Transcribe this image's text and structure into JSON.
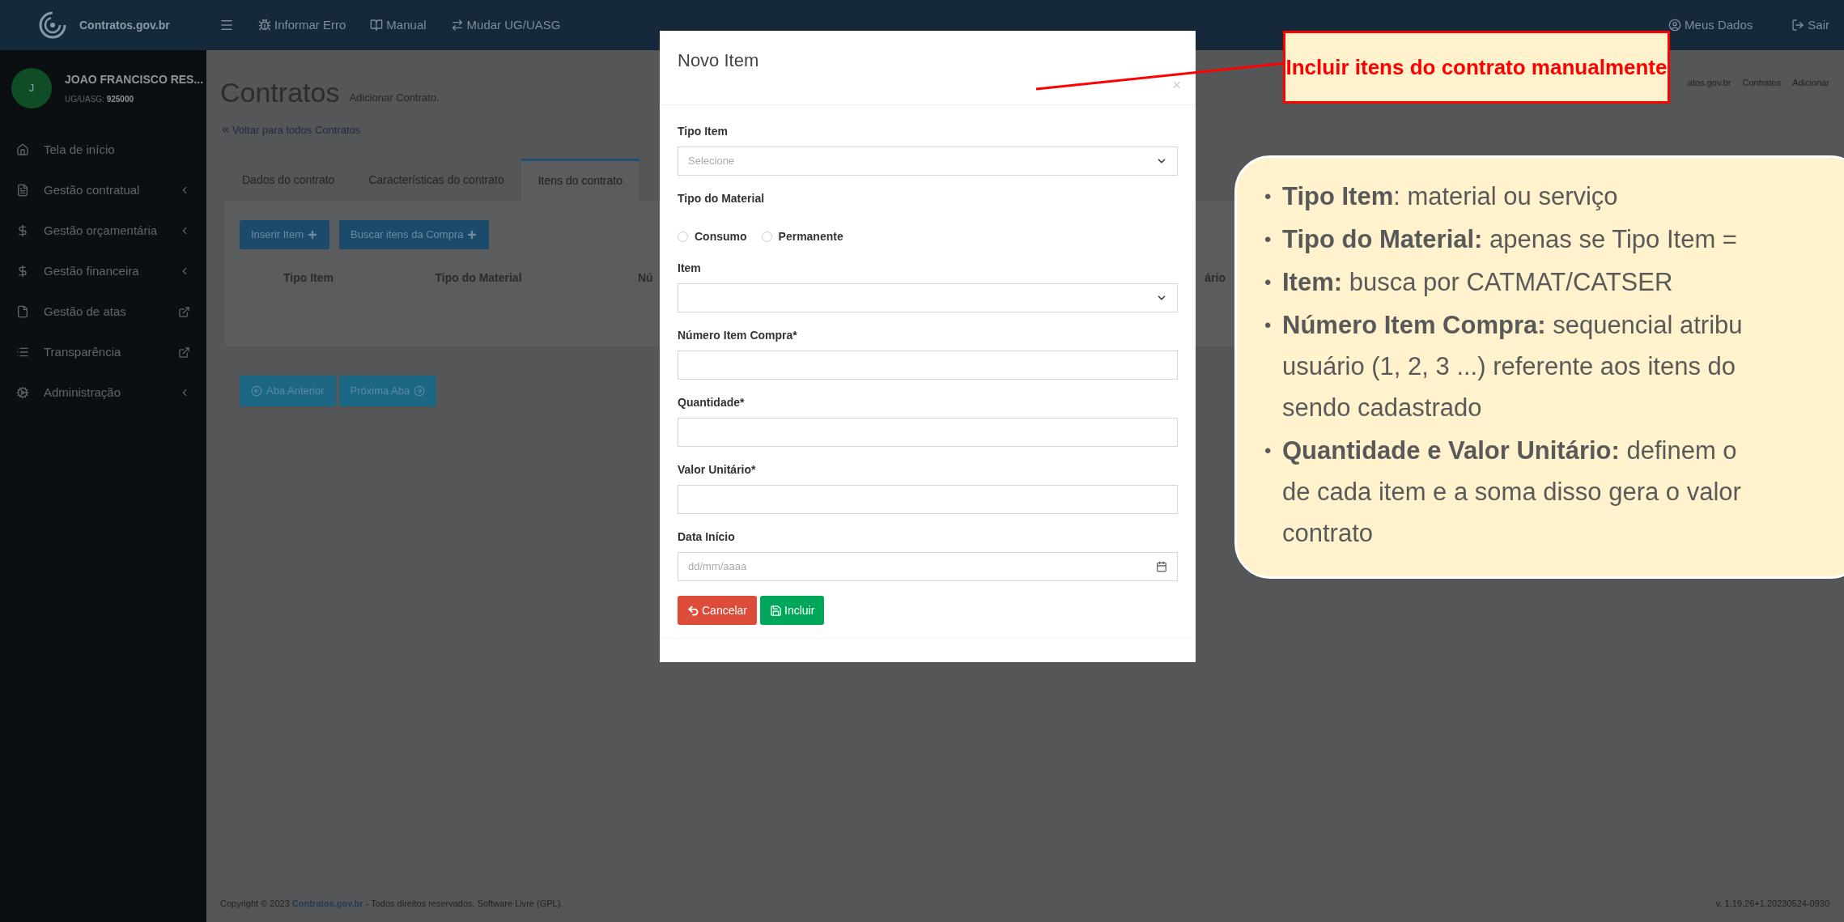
{
  "topbar": {
    "brand": "Contratos.gov.br",
    "links": [
      "Informar Erro",
      "Manual",
      "Mudar UG/UASG"
    ],
    "right_links": [
      "Meus Dados",
      "Sair"
    ]
  },
  "user": {
    "initial": "J",
    "name": "JOAO FRANCISCO RES...",
    "unit_label": "UG/UASG:",
    "unit_code": "925000"
  },
  "sidebar": {
    "items": [
      {
        "label": "Tela de início",
        "kind": "link"
      },
      {
        "label": "Gestão contratual",
        "kind": "submenu"
      },
      {
        "label": "Gestão orçamentária",
        "kind": "submenu"
      },
      {
        "label": "Gestão financeira",
        "kind": "submenu"
      },
      {
        "label": "Gestão de atas",
        "kind": "external"
      },
      {
        "label": "Transparência",
        "kind": "external"
      },
      {
        "label": "Administração",
        "kind": "submenu"
      }
    ]
  },
  "page": {
    "title": "Contratos",
    "subtitle": "Adicionar Contrato.",
    "back_link": "Voltar para todos Contratos",
    "breadcrumb": [
      "atos.gov.br",
      "Contratos",
      "Adicionar"
    ]
  },
  "tabs": [
    {
      "label": "Dados do contrato",
      "selected": false
    },
    {
      "label": "Características do contrato",
      "selected": false
    },
    {
      "label": "Itens do contrato",
      "selected": true
    }
  ],
  "panel_buttons": [
    "Inserir Item",
    "Buscar itens da Compra"
  ],
  "table": {
    "columns": [
      "Tipo Item",
      "Tipo do Material",
      "Nú",
      "ário"
    ]
  },
  "nav_buttons": [
    "Aba Anterior",
    "Próxima Aba"
  ],
  "modal": {
    "title": "Novo Item",
    "close": "×",
    "fields": [
      {
        "kind": "select",
        "label": "Tipo Item",
        "placeholder": "Selecione"
      },
      {
        "kind": "radio",
        "label": "Tipo do Material",
        "options": [
          {
            "label": "Consumo",
            "checked": false
          },
          {
            "label": "Permanente",
            "checked": false
          }
        ]
      },
      {
        "kind": "select",
        "label": "Item"
      },
      {
        "kind": "text",
        "label": "Número Item Compra*"
      },
      {
        "kind": "text",
        "label": "Quantidade*"
      },
      {
        "kind": "text",
        "label": "Valor Unitário*"
      },
      {
        "kind": "date",
        "label": "Data Início",
        "placeholder": "dd/mm/aaaa"
      }
    ],
    "buttons": [
      {
        "label": "Cancelar",
        "kind": "cancel"
      },
      {
        "label": "Incluir",
        "kind": "save"
      }
    ]
  },
  "footer": {
    "copyright": "Copyright © 2023",
    "brand": "Contratos.gov.br",
    "rights": "- Todos direitos reservados. Software Livre (GPL).",
    "version": "v. 1.19.26+1.20230524-0930"
  },
  "annotation": {
    "label": "Incluir itens do contrato manualmente",
    "bullet": "•",
    "bullets": [
      [
        "**Tipo Item**: material ou serviço"
      ],
      [
        "**Tipo do Material:** apenas se Tipo Item ="
      ],
      [
        "**Item:** busca por CATMAT/CATSER"
      ],
      [
        "**Número Item Compra:** sequencial atribu",
        "usuário (1, 2, 3 ...) referente aos itens do",
        "sendo cadastrado"
      ],
      [
        "**Quantidade e Valor Unitário:** definem o",
        "de cada item e a soma disso gera o valor",
        "contrato"
      ]
    ]
  }
}
